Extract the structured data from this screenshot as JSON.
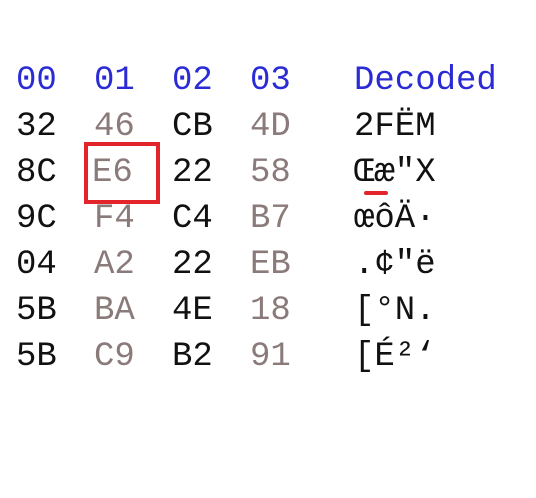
{
  "header": {
    "col0": "00",
    "col1": "01",
    "col2": "02",
    "col3": "03",
    "decoded": "Decoded"
  },
  "rows": [
    {
      "b0": "32",
      "b1": "46",
      "b2": "CB",
      "b3": "4D",
      "decoded": "2FËM"
    },
    {
      "b0": "8C",
      "b1": "E6",
      "b2": "22",
      "b3": "58",
      "decoded": "Œæ\"X"
    },
    {
      "b0": "9C",
      "b1": "F4",
      "b2": "C4",
      "b3": "B7",
      "decoded": "œôÄ·"
    },
    {
      "b0": "04",
      "b1": "A2",
      "b2": "22",
      "b3": "EB",
      "decoded": ".¢\"ë"
    },
    {
      "b0": "5B",
      "b1": "BA",
      "b2": "4E",
      "b3": "18",
      "decoded": "[°N."
    },
    {
      "b0": "5B",
      "b1": "C9",
      "b2": "B2",
      "b3": "91",
      "decoded": "[É²‘"
    }
  ],
  "selection": {
    "row": 1,
    "col": 1,
    "value": "E6",
    "highlight_color": "#e3242b"
  },
  "colors": {
    "header": "#2b2bd6",
    "even_bytes": "#111111",
    "odd_bytes": "#8a7a7a"
  }
}
